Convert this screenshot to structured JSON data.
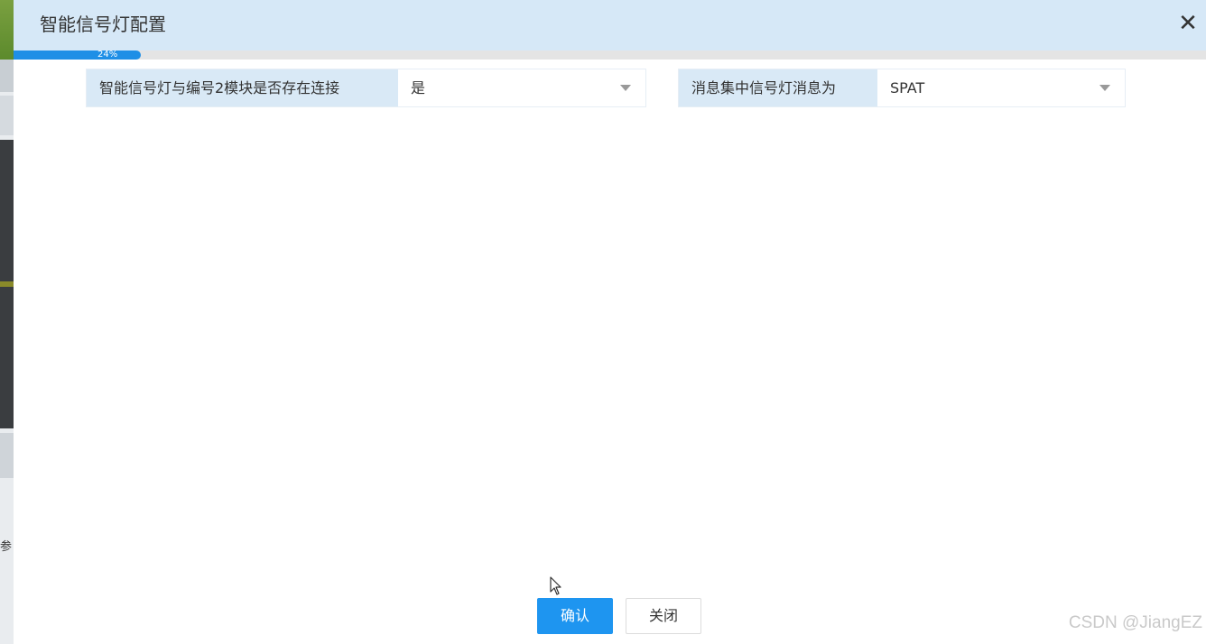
{
  "dialog": {
    "title": "智能信号灯配置",
    "close_glyph": "✕",
    "progress_text": "24%",
    "progress_value": 0.24
  },
  "form": {
    "connection": {
      "label": "智能信号灯与编号2模块是否存在连接",
      "value": "是"
    },
    "message": {
      "label": "消息集中信号灯消息为",
      "value": "SPAT"
    }
  },
  "buttons": {
    "confirm": "确认",
    "close": "关闭"
  },
  "background": {
    "side_text": "参"
  },
  "watermark": "CSDN @JiangEZ",
  "colors": {
    "title_bar": "#d6e8f7",
    "field_label_bg": "#d9e9f6",
    "accent": "#1e95f0"
  }
}
